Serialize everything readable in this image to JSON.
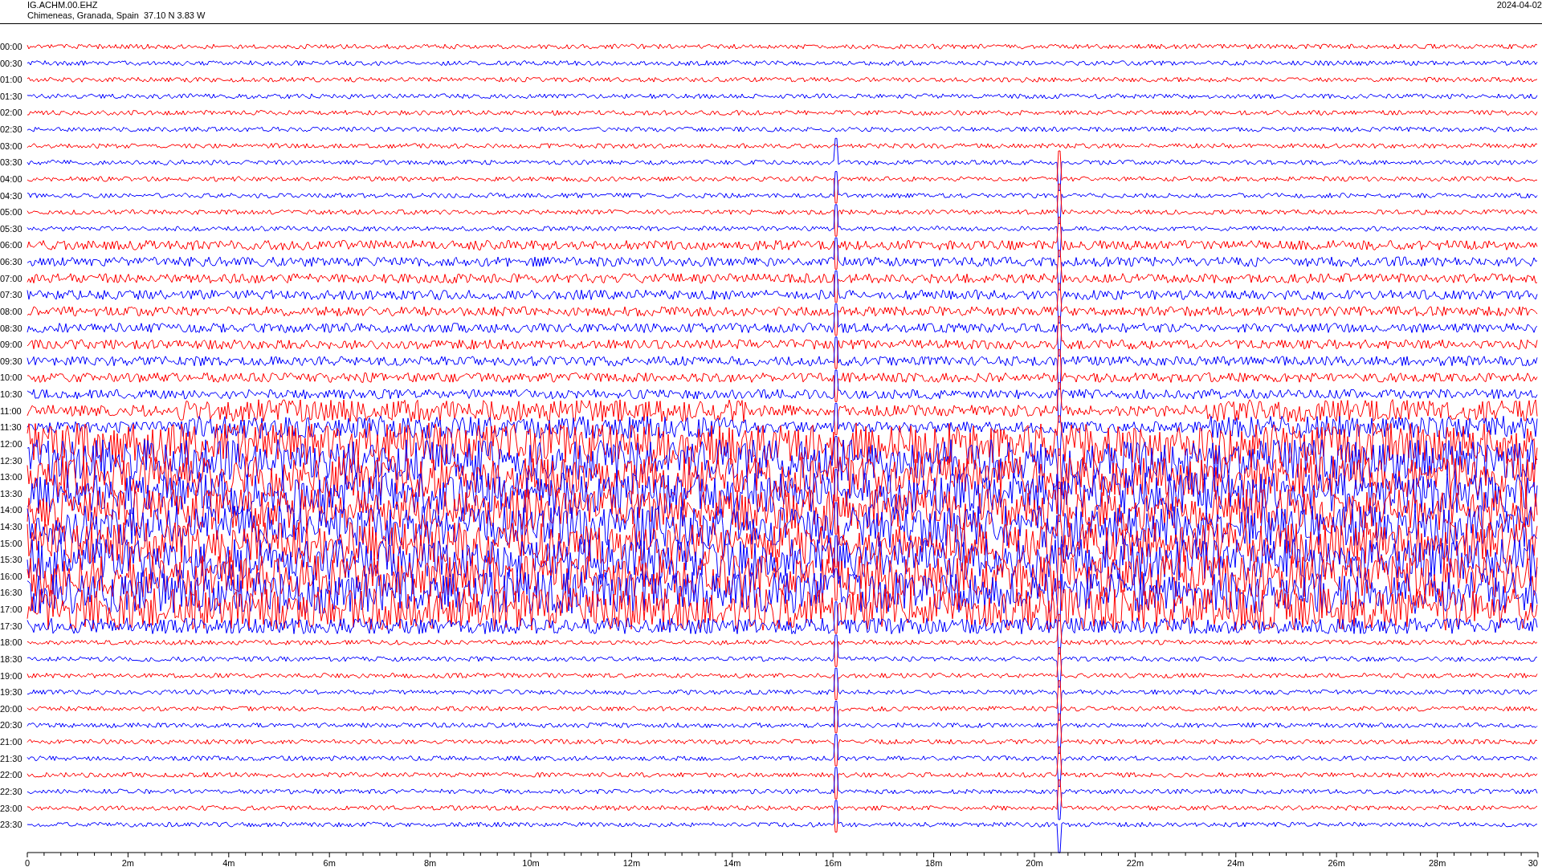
{
  "header": {
    "station": "IG.ACHM.00.EHZ",
    "location": "Chimeneas, Granada, Spain  37.10 N 3.83 W",
    "date": "2024-04-02"
  },
  "rows": [
    {
      "label": "00:00",
      "color": "#ff0000"
    },
    {
      "label": "00:30",
      "color": "#0000ff"
    },
    {
      "label": "01:00",
      "color": "#ff0000"
    },
    {
      "label": "01:30",
      "color": "#0000ff"
    },
    {
      "label": "02:00",
      "color": "#ff0000"
    },
    {
      "label": "02:30",
      "color": "#0000ff"
    },
    {
      "label": "03:00",
      "color": "#ff0000"
    },
    {
      "label": "03:30",
      "color": "#0000ff"
    },
    {
      "label": "04:00",
      "color": "#ff0000"
    },
    {
      "label": "04:30",
      "color": "#0000ff"
    },
    {
      "label": "05:00",
      "color": "#ff0000"
    },
    {
      "label": "05:30",
      "color": "#0000ff"
    },
    {
      "label": "06:00",
      "color": "#ff0000"
    },
    {
      "label": "06:30",
      "color": "#0000ff"
    },
    {
      "label": "07:00",
      "color": "#ff0000"
    },
    {
      "label": "07:30",
      "color": "#0000ff"
    },
    {
      "label": "08:00",
      "color": "#ff0000"
    },
    {
      "label": "08:30",
      "color": "#0000ff"
    },
    {
      "label": "09:00",
      "color": "#ff0000"
    },
    {
      "label": "09:30",
      "color": "#0000ff"
    },
    {
      "label": "10:00",
      "color": "#ff0000"
    },
    {
      "label": "10:30",
      "color": "#0000ff"
    },
    {
      "label": "11:00",
      "color": "#ff0000"
    },
    {
      "label": "11:30",
      "color": "#0000ff"
    },
    {
      "label": "12:00",
      "color": "#ff0000"
    },
    {
      "label": "12:30",
      "color": "#0000ff"
    },
    {
      "label": "13:00",
      "color": "#ff0000"
    },
    {
      "label": "13:30",
      "color": "#0000ff"
    },
    {
      "label": "14:00",
      "color": "#ff0000"
    },
    {
      "label": "14:30",
      "color": "#0000ff"
    },
    {
      "label": "15:00",
      "color": "#ff0000"
    },
    {
      "label": "15:30",
      "color": "#0000ff"
    },
    {
      "label": "16:00",
      "color": "#ff0000"
    },
    {
      "label": "16:30",
      "color": "#0000ff"
    },
    {
      "label": "17:00",
      "color": "#ff0000"
    },
    {
      "label": "17:30",
      "color": "#0000ff"
    },
    {
      "label": "18:00",
      "color": "#ff0000"
    },
    {
      "label": "18:30",
      "color": "#0000ff"
    },
    {
      "label": "19:00",
      "color": "#ff0000"
    },
    {
      "label": "19:30",
      "color": "#0000ff"
    },
    {
      "label": "20:00",
      "color": "#ff0000"
    },
    {
      "label": "20:30",
      "color": "#0000ff"
    },
    {
      "label": "21:00",
      "color": "#ff0000"
    },
    {
      "label": "21:30",
      "color": "#0000ff"
    },
    {
      "label": "22:00",
      "color": "#ff0000"
    },
    {
      "label": "22:30",
      "color": "#0000ff"
    },
    {
      "label": "23:00",
      "color": "#ff0000"
    },
    {
      "label": "23:30",
      "color": "#0000ff"
    }
  ],
  "x_axis": {
    "labels": [
      "0",
      "2m",
      "4m",
      "6m",
      "8m",
      "10m",
      "12m",
      "14m",
      "16m",
      "18m",
      "20m",
      "22m",
      "24m",
      "26m",
      "28m",
      "30"
    ]
  }
}
